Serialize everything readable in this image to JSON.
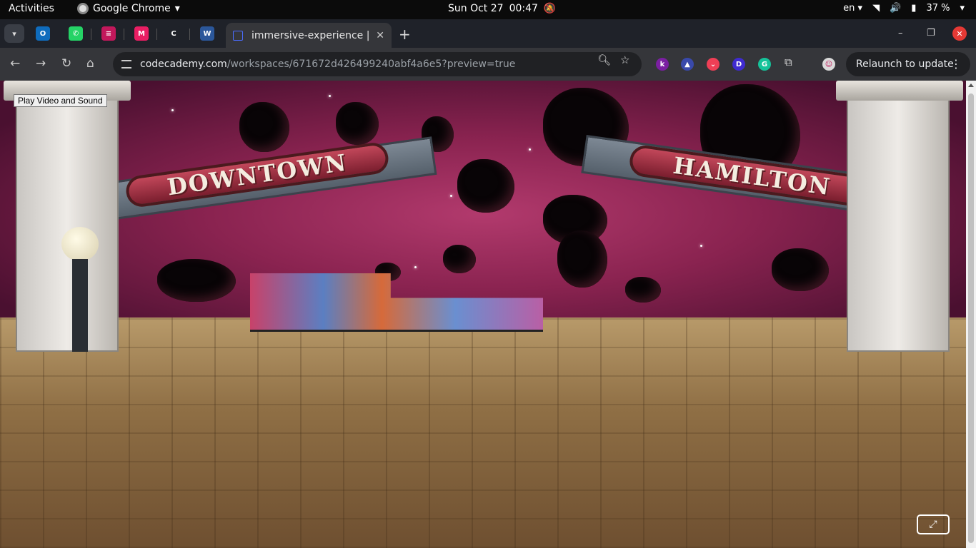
{
  "system_bar": {
    "activities": "Activities",
    "app_name": "Google Chrome",
    "date": "Sun Oct 27",
    "time": "00:47",
    "language": "en",
    "battery": "37 %"
  },
  "tabs": {
    "active_title": "immersive-experience | H",
    "pinned": [
      {
        "name": "outlook",
        "letter": "O",
        "color": "#0f6cbd"
      },
      {
        "name": "whatsapp",
        "letter": "✆",
        "color": "#25d366"
      },
      {
        "name": "app-stack",
        "letter": "≡",
        "color": "#c2185b"
      },
      {
        "name": "app-tiles",
        "letter": "M",
        "color": "#e91e63"
      },
      {
        "name": "codecademy",
        "letter": "C",
        "color": "#1f2229"
      },
      {
        "name": "word",
        "letter": "W",
        "color": "#2b579a"
      }
    ]
  },
  "toolbar": {
    "url_host": "codecademy.com",
    "url_path": "/workspaces/671672d426499240abf4a6e5?preview=true",
    "relaunch_label": "Relaunch to update",
    "extensions": [
      {
        "name": "k-extension",
        "letter": "k",
        "color": "#7b1fa2"
      },
      {
        "name": "rocket-extension",
        "letter": "▲",
        "color": "#3949ab"
      },
      {
        "name": "pocket-extension",
        "letter": "⌄",
        "color": "#ef3f56"
      },
      {
        "name": "d-extension",
        "letter": "D",
        "color": "#3f2bd1"
      },
      {
        "name": "grammarly-extension",
        "letter": "G",
        "color": "#15c39a"
      }
    ]
  },
  "scene": {
    "play_button": "Play Video and Sound",
    "sign_left": "DOWNTOWN",
    "sign_right": "HAMILTON",
    "colors": {
      "sky": "#8a2350",
      "ground": "#8f6f45"
    }
  }
}
